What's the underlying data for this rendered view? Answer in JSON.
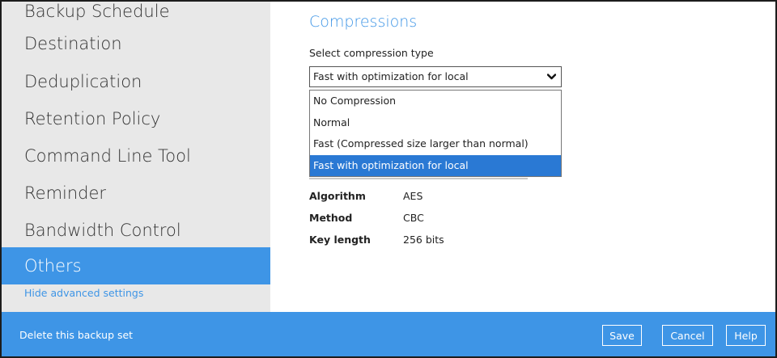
{
  "sidebar": {
    "items": [
      {
        "label": "Backup Schedule"
      },
      {
        "label": "Destination"
      },
      {
        "label": "Deduplication"
      },
      {
        "label": "Retention Policy"
      },
      {
        "label": "Command Line Tool"
      },
      {
        "label": "Reminder"
      },
      {
        "label": "Bandwidth Control"
      },
      {
        "label": "Others"
      }
    ],
    "active_item": "Others",
    "hide_advanced_label": "Hide advanced settings"
  },
  "main": {
    "section_title": "Compressions",
    "compression": {
      "label": "Select compression type",
      "selected_value": "Fast with optimization for local",
      "options": [
        "No Compression",
        "Normal",
        "Fast (Compressed size larger than normal)",
        "Fast with optimization for local"
      ]
    },
    "encryption": {
      "rows": [
        {
          "key": "Algorithm",
          "value": "AES"
        },
        {
          "key": "Method",
          "value": "CBC"
        },
        {
          "key": "Key length",
          "value": "256 bits"
        }
      ]
    }
  },
  "footer": {
    "delete_label": "Delete this backup set",
    "save_label": "Save",
    "cancel_label": "Cancel",
    "help_label": "Help"
  },
  "colors": {
    "accent": "#3e95e6",
    "selected_option": "#2a79d4",
    "sidebar_bg": "#e8e8e8"
  }
}
